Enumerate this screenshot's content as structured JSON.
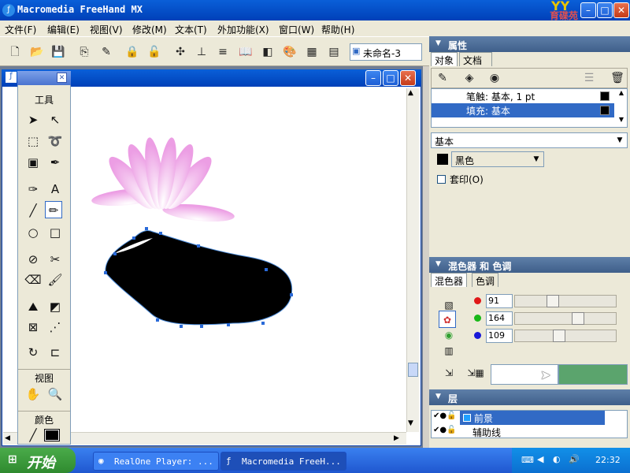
{
  "app": {
    "title": "Macromedia FreeHand MX",
    "brand_logo_text": "育碟苑",
    "doc_name": "未命名-3"
  },
  "menu": [
    "文件(F)",
    "编辑(E)",
    "视图(V)",
    "修改(M)",
    "文本(T)",
    "外加功能(X)",
    "窗口(W)",
    "帮助(H)"
  ],
  "tools_panel": {
    "title": "工具",
    "view_label": "视图",
    "color_label": "颜色"
  },
  "properties_panel": {
    "title": "属性",
    "tabs": [
      "对象",
      "文档"
    ],
    "stroke_row": "笔触: 基本, 1 pt",
    "fill_row": "填充: 基本",
    "type_select": "基本",
    "color_select": "黑色",
    "overprint_label": "套印(O)"
  },
  "mixer_panel": {
    "title": "混色器 和 色调",
    "tabs": [
      "混色器",
      "色调"
    ],
    "r": "91",
    "g": "164",
    "b": "109",
    "r_level": 0.357,
    "g_level": 0.643,
    "b_level": 0.427,
    "mixed_color": "#5ba46d"
  },
  "layers_panel": {
    "title": "层",
    "layers": [
      "前景",
      "辅助线"
    ]
  },
  "taskbar": {
    "start": "开始",
    "tasks": [
      "RealOne Player: ...",
      "Macromedia FreeH..."
    ],
    "clock": "22:32"
  },
  "colors": {
    "accent": "#316ac5",
    "lotus_pink": "#f0a8e8",
    "mixed_green": "#5ba46d"
  }
}
